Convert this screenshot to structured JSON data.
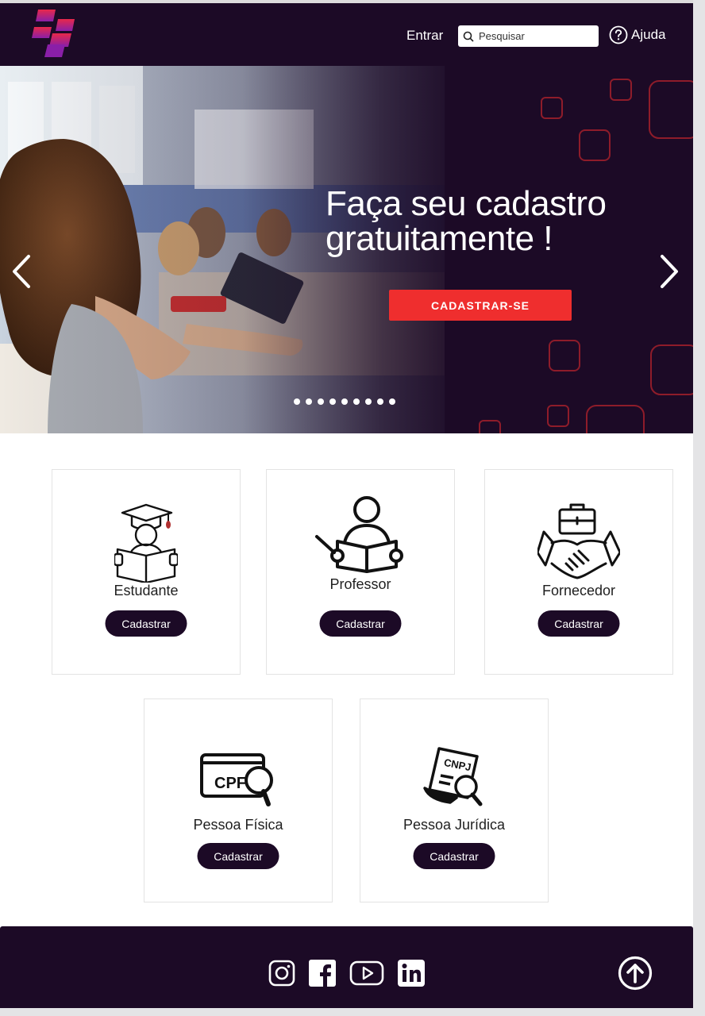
{
  "header": {
    "login_label": "Entrar",
    "search_placeholder": "Pesquisar",
    "help_label": "Ajuda"
  },
  "hero": {
    "title_line1": "Faça seu cadastro",
    "title_line2": "gratuitamente !",
    "cta_label": "CADASTRAR-SE",
    "slide_count": 9
  },
  "cards": [
    {
      "label": "Estudante",
      "button": "Cadastrar",
      "icon": "student-icon"
    },
    {
      "label": "Professor",
      "button": "Cadastrar",
      "icon": "teacher-icon"
    },
    {
      "label": "Fornecedor",
      "button": "Cadastrar",
      "icon": "supplier-handshake-icon"
    },
    {
      "label": "Pessoa Física",
      "button": "Cadastrar",
      "icon": "cpf-search-icon"
    },
    {
      "label": "Pessoa Jurídica",
      "button": "Cadastrar",
      "icon": "cnpj-search-icon"
    }
  ],
  "footer": {
    "social": [
      "instagram-icon",
      "facebook-icon",
      "youtube-icon",
      "linkedin-icon"
    ]
  },
  "colors": {
    "brand_dark": "#1c0a26",
    "accent_red": "#ef2e2e",
    "logo_pink": "#e8284a",
    "logo_purple": "#8a1fa8"
  }
}
